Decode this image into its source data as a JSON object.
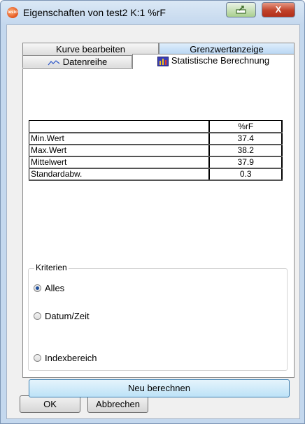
{
  "window": {
    "title": "Eigenschaften von test2 K:1 %rF",
    "app_icon_text": "testo",
    "close_label": "X"
  },
  "tabs": {
    "row1": [
      {
        "label": "Kurve bearbeiten"
      },
      {
        "label": "Grenzwertanzeige"
      }
    ],
    "row2": [
      {
        "label": "Datenreihe"
      },
      {
        "label": "Statistische Berechnung",
        "active": true
      }
    ]
  },
  "stats": {
    "header_label": "",
    "unit_header": "%rF",
    "rows": [
      {
        "label": "Min.Wert",
        "value": "37.4"
      },
      {
        "label": "Max.Wert",
        "value": "38.2"
      },
      {
        "label": "Mittelwert",
        "value": "37.9"
      },
      {
        "label": "Standardabw.",
        "value": "0.3"
      }
    ]
  },
  "criteria": {
    "legend": "Kriterien",
    "options": [
      {
        "label": "Alles",
        "checked": true
      },
      {
        "label": "Datum/Zeit",
        "checked": false
      },
      {
        "label": "Indexbereich",
        "checked": false
      }
    ]
  },
  "buttons": {
    "recalculate": "Neu berechnen",
    "ok": "OK",
    "cancel": "Abbrechen"
  }
}
